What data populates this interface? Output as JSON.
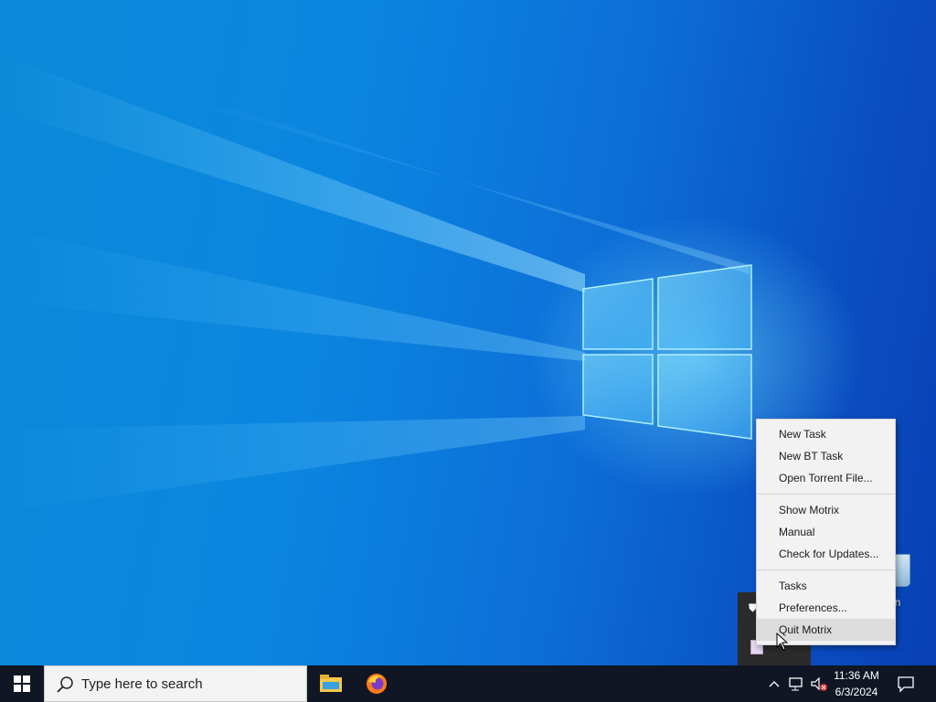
{
  "desktop": {
    "recycle_bin": {
      "label": "e Bin",
      "icon": "recycle-bin-icon"
    }
  },
  "context_menu": {
    "items": [
      {
        "label": "New Task"
      },
      {
        "label": "New BT Task"
      },
      {
        "label": "Open Torrent File..."
      },
      {
        "label": "Show Motrix"
      },
      {
        "label": "Manual"
      },
      {
        "label": "Check for Updates..."
      },
      {
        "label": "Tasks"
      },
      {
        "label": "Preferences..."
      },
      {
        "label": "Quit Motrix",
        "highlighted": true
      }
    ]
  },
  "taskbar": {
    "start_icon": "windows-start-icon",
    "search": {
      "placeholder": "Type here to search",
      "icon": "search-icon"
    },
    "pinned_apps": [
      {
        "name": "File Explorer",
        "icon": "file-explorer-icon"
      },
      {
        "name": "Firefox",
        "icon": "firefox-icon"
      }
    ],
    "tray": {
      "icons": [
        "chevron-up-icon",
        "network-icon",
        "volume-muted-icon"
      ],
      "time": "11:36 AM",
      "date": "6/3/2024",
      "notification_icon": "action-center-icon"
    }
  },
  "colors": {
    "taskbar_bg": "#101624",
    "menu_bg": "#f2f2f2",
    "menu_highlight": "#dcdcdc",
    "desktop_blue": "#0b86e0"
  }
}
